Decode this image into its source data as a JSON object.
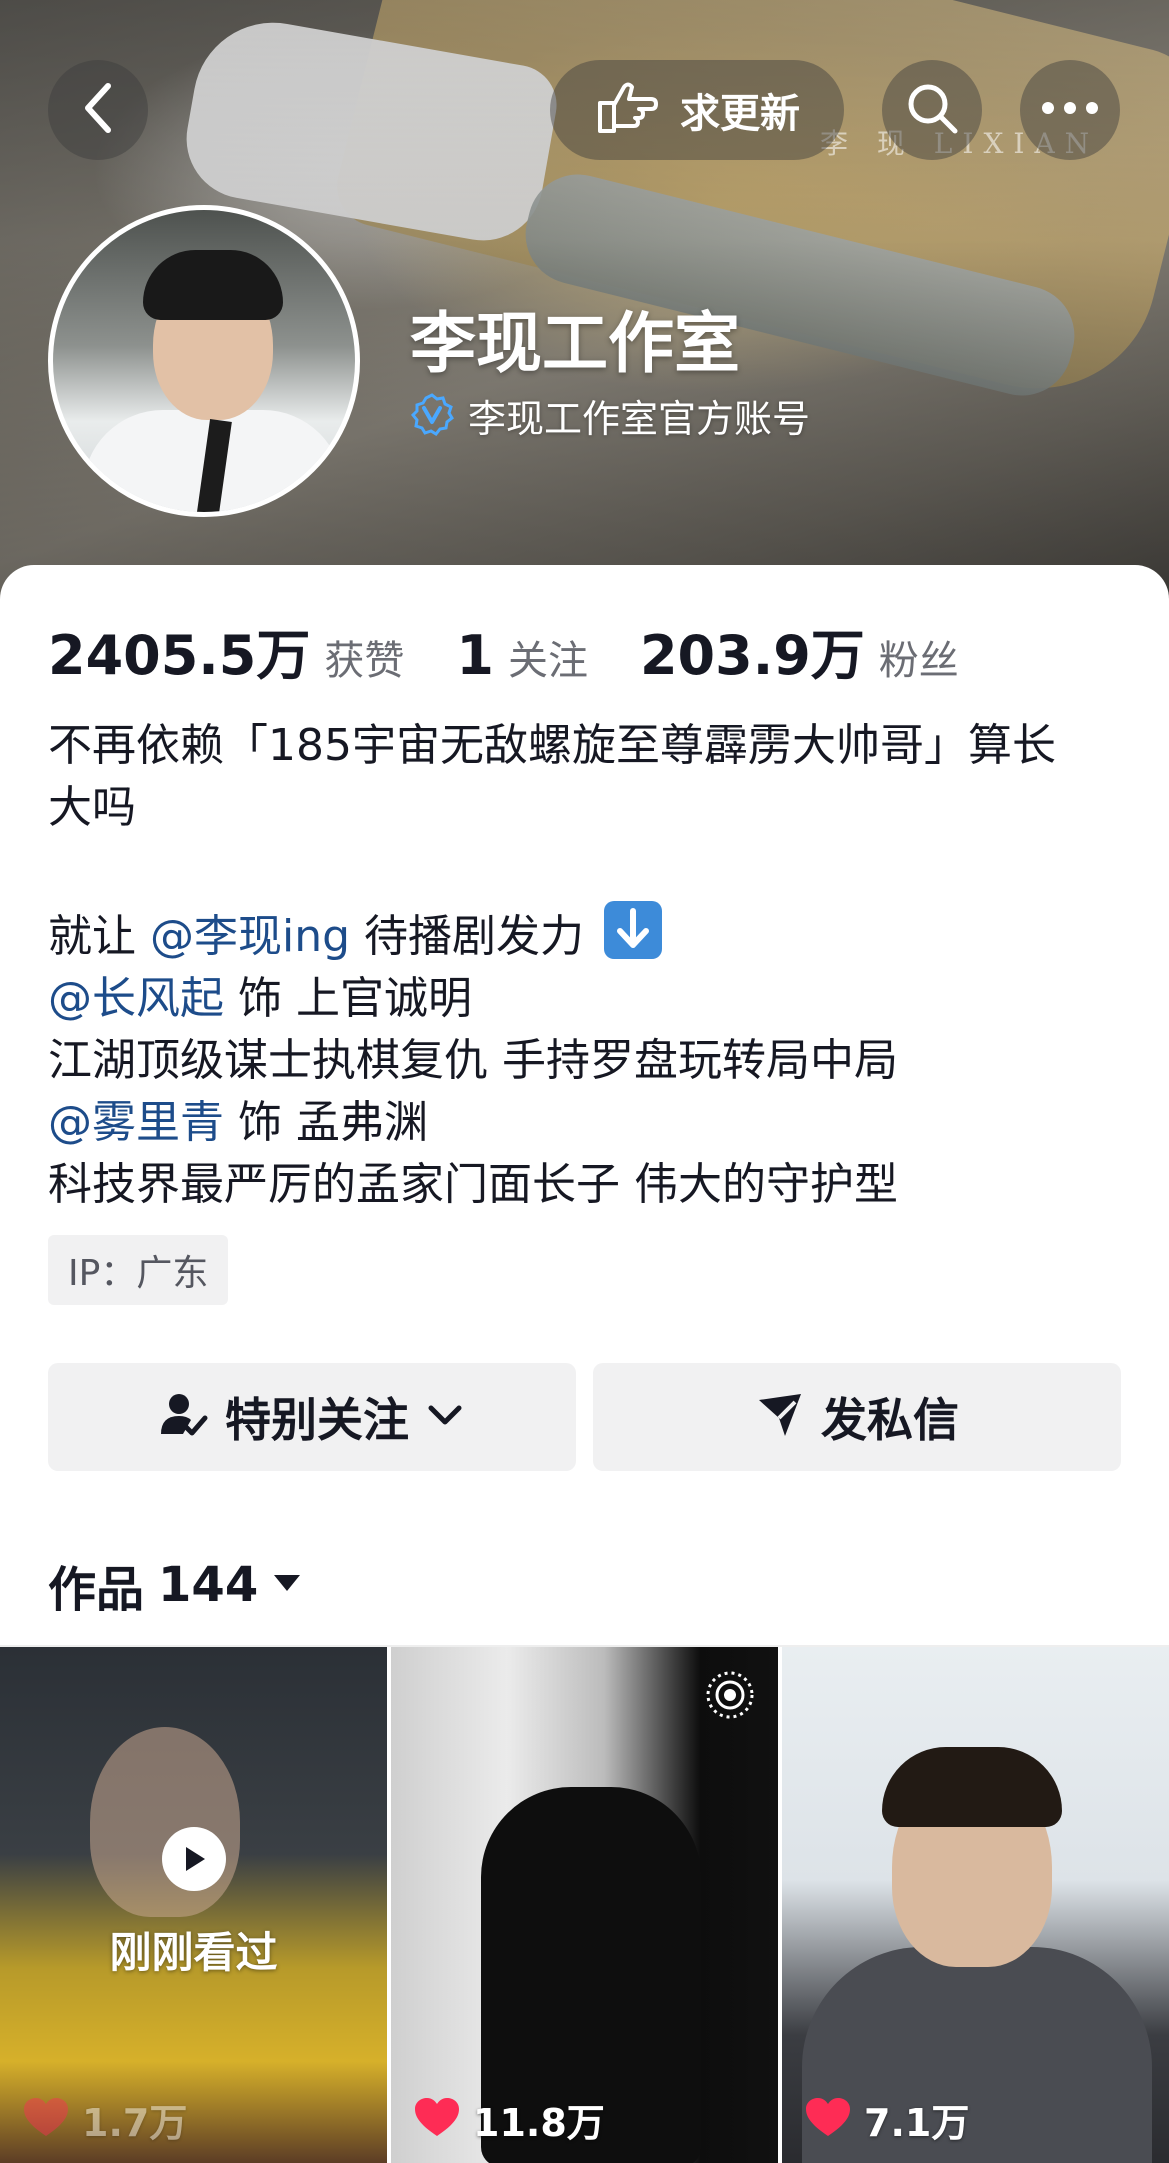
{
  "header": {
    "back_icon": "chevron-left-icon",
    "update_button": {
      "label": "求更新",
      "icon": "pointing-hand-icon"
    },
    "search_icon": "search-icon",
    "more_icon": "more-dots-icon",
    "banner_watermark": "李 现 LIXIAN"
  },
  "profile": {
    "name": "李现工作室",
    "verification": "李现工作室官方账号",
    "verification_icon": "verified-badge-icon"
  },
  "stats": [
    {
      "value": "2405.5万",
      "label": "获赞"
    },
    {
      "value": "1",
      "label": "关注"
    },
    {
      "value": "203.9万",
      "label": "粉丝"
    }
  ],
  "bio": {
    "line1": "不再依赖「185宇宙无敌螺旋至尊霹雳大帅哥」算长",
    "line2": "大吗",
    "line3_prefix": "就让",
    "line3_mention": "@李现ing",
    "line3_suffix": "待播剧发力",
    "line4_mention": "@长风起",
    "line4_suffix": "饰 上官诚明",
    "line5": "江湖顶级谋士执棋复仇 手持罗盘玩转局中局",
    "line6_mention": "@雾里青",
    "line6_suffix": "饰 孟弗渊",
    "line7": "科技界最严厉的孟家门面长子 伟大的守护型"
  },
  "ip_tag": "IP：广东",
  "actions": {
    "follow": {
      "label": "特别关注",
      "icon": "user-check-icon"
    },
    "message": {
      "label": "发私信",
      "icon": "send-icon"
    }
  },
  "works_tab": {
    "label": "作品",
    "count": "144"
  },
  "videos": [
    {
      "overlay": "刚刚看过",
      "likes": "1.7万"
    },
    {
      "likes": "11.8万"
    },
    {
      "likes": "7.1万"
    }
  ],
  "colors": {
    "mention": "#1d4c8a",
    "verify": "#4aa8ff",
    "heart": "#fe2c55"
  }
}
